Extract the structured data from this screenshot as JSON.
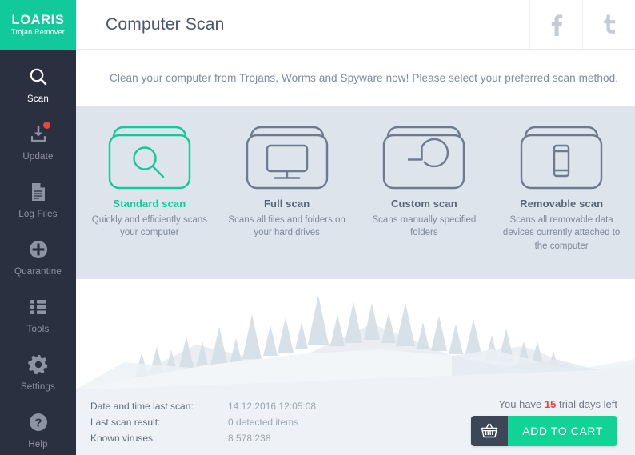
{
  "brand": {
    "name": "LOARIS",
    "tagline": "Trojan Remover",
    "green": "#12c99b"
  },
  "sidebar": {
    "items": [
      {
        "label": "Scan",
        "icon": "magnifier-icon",
        "active": true,
        "badge": false
      },
      {
        "label": "Update",
        "icon": "download-tray-icon",
        "active": false,
        "badge": true
      },
      {
        "label": "Log Files",
        "icon": "document-icon",
        "active": false,
        "badge": false
      },
      {
        "label": "Quarantine",
        "icon": "plus-circle-icon",
        "active": false,
        "badge": false
      },
      {
        "label": "Tools",
        "icon": "list-icon",
        "active": false,
        "badge": false
      },
      {
        "label": "Settings",
        "icon": "gear-icon",
        "active": false,
        "badge": false
      },
      {
        "label": "Help",
        "icon": "question-circle-icon",
        "active": false,
        "badge": false
      }
    ]
  },
  "header": {
    "title": "Computer Scan",
    "social": [
      {
        "name": "facebook-icon",
        "glyph": "f"
      },
      {
        "name": "twitter-icon",
        "glyph": "t"
      }
    ]
  },
  "subheader": {
    "text": "Clean your computer from Trojans, Worms and Spyware now! Please select your preferred scan method."
  },
  "scan_methods": [
    {
      "title": "Standard scan",
      "description": "Quickly and efficiently scans your computer",
      "icon": "magnifier-card-icon",
      "selected": true
    },
    {
      "title": "Full scan",
      "description": "Scans all files and folders on your hard drives",
      "icon": "monitor-card-icon",
      "selected": false
    },
    {
      "title": "Custom scan",
      "description": "Scans manually specified folders",
      "icon": "pie-chart-card-icon",
      "selected": false
    },
    {
      "title": "Removable scan",
      "description": "Scans all removable data devices currently attached to the computer",
      "icon": "usb-drive-card-icon",
      "selected": false
    }
  ],
  "footer": {
    "rows": [
      {
        "label": "Date and time last scan:",
        "value": "14.12.2016 12:05:08"
      },
      {
        "label": "Last scan result:",
        "value": "0 detected items"
      },
      {
        "label": "Known viruses:",
        "value": "8 578 238"
      }
    ],
    "trial_prefix": "You have",
    "trial_days": "15",
    "trial_suffix": "trial days left",
    "cart_button_label": "ADD TO CART",
    "cart_icon": "shopping-basket-icon"
  }
}
